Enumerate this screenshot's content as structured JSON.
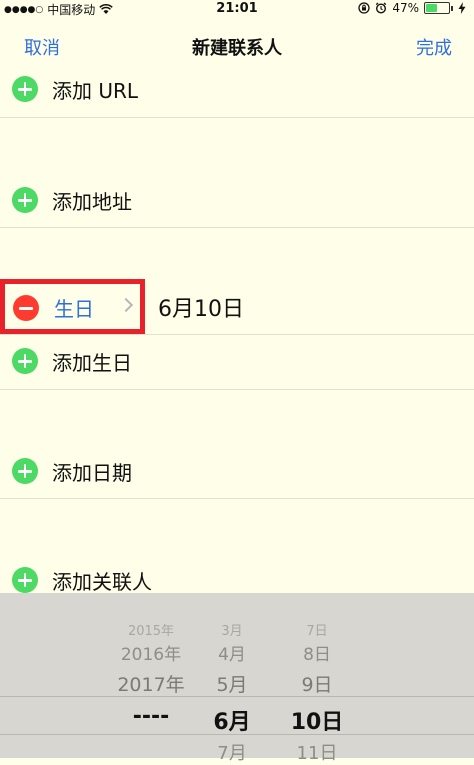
{
  "status_bar": {
    "signal_dots": "●●●●○",
    "carrier": "中国移动",
    "time": "21:01",
    "battery": "47%",
    "battery_level": 0.47
  },
  "nav": {
    "cancel": "取消",
    "title": "新建联系人",
    "done": "完成"
  },
  "rows": {
    "add_url": "添加 URL",
    "add_address": "添加地址",
    "birthday_label": "生日",
    "birthday_value": "6月10日",
    "add_birthday": "添加生日",
    "add_date": "添加日期",
    "add_related": "添加关联人"
  },
  "picker": {
    "year": [
      "2015年",
      "2016年",
      "2017年",
      "----",
      ""
    ],
    "month": [
      "3月",
      "4月",
      "5月",
      "6月",
      "7月"
    ],
    "day": [
      "7日",
      "8日",
      "9日",
      "10日",
      "11日"
    ]
  },
  "colors": {
    "background": "#fefee9",
    "accent_blue": "#2f6fde",
    "add_green": "#4cd964",
    "delete_red": "#ff3b30",
    "highlight_red": "#e8212b"
  },
  "icons": [
    "wifi-icon",
    "lock-rotation-icon",
    "alarm-icon",
    "battery-icon",
    "charging-icon",
    "plus-circle-icon",
    "minus-circle-icon",
    "chevron-right-icon"
  ]
}
